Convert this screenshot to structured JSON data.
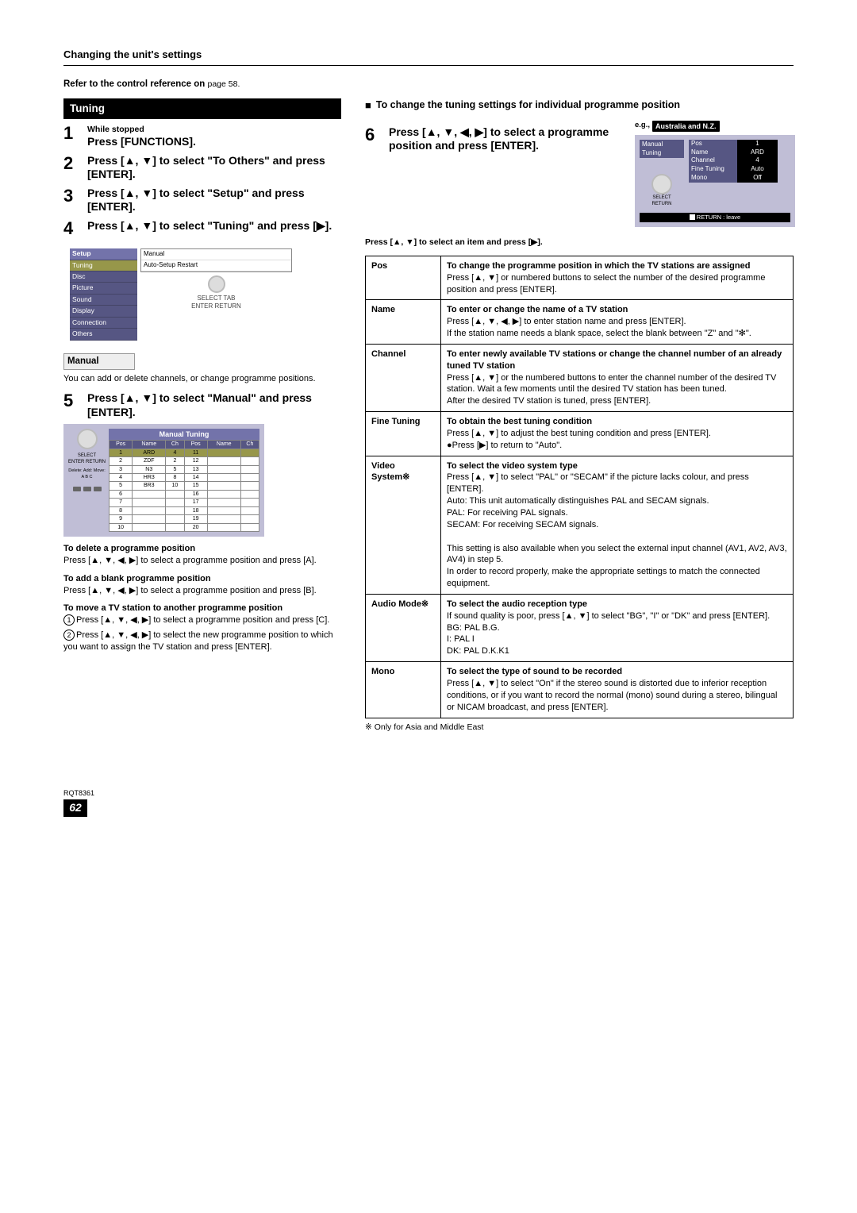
{
  "header": {
    "title": "Changing the unit's settings",
    "ref": "Refer to the control reference on ",
    "ref_page": "page 58."
  },
  "tuning_label": "Tuning",
  "steps": {
    "s1_small": "While stopped",
    "s1_main": "Press [FUNCTIONS].",
    "s2": "Press [▲, ▼] to select \"To Others\" and press [ENTER].",
    "s3": "Press [▲, ▼] to select \"Setup\" and press [ENTER].",
    "s4": "Press [▲, ▼] to select \"Tuning\" and press [▶].",
    "s5": "Press [▲, ▼] to select \"Manual\" and press [ENTER].",
    "s6": "Press [▲, ▼, ◀, ▶] to select a programme position and press [ENTER]."
  },
  "setup_box": {
    "menu": [
      "Setup",
      "Tuning",
      "Disc",
      "Picture",
      "Sound",
      "Display",
      "Connection",
      "Others"
    ],
    "panel": [
      "Manual",
      "Auto-Setup Restart"
    ],
    "icons": "SELECT    TAB\nENTER    RETURN"
  },
  "manual_head": "Manual",
  "manual_text": "You can add or delete channels, or change programme positions.",
  "mt": {
    "title": "Manual Tuning",
    "headers": [
      "Pos",
      "Name",
      "Ch",
      "Pos",
      "Name",
      "Ch"
    ],
    "rows": [
      [
        "1",
        "ARD",
        "4",
        "11",
        "",
        ""
      ],
      [
        "2",
        "ZDF",
        "2",
        "12",
        "",
        ""
      ],
      [
        "3",
        "N3",
        "5",
        "13",
        "",
        ""
      ],
      [
        "4",
        "HR3",
        "8",
        "14",
        "",
        ""
      ],
      [
        "5",
        "BR3",
        "10",
        "15",
        "",
        ""
      ],
      [
        "6",
        "",
        "",
        "16",
        "",
        ""
      ],
      [
        "7",
        "",
        "",
        "17",
        "",
        ""
      ],
      [
        "8",
        "",
        "",
        "18",
        "",
        ""
      ],
      [
        "9",
        "",
        "",
        "19",
        "",
        ""
      ],
      [
        "10",
        "",
        "",
        "20",
        "",
        ""
      ]
    ],
    "knob_labels": "SELECT\nENTER   RETURN",
    "bottom": "Delete:  Add:  Move:\n A       B     C"
  },
  "paras": {
    "del_h": "To delete a programme position",
    "del_b": "Press [▲, ▼, ◀, ▶] to select a programme position and press [A].",
    "add_h": "To add a blank programme position",
    "add_b": "Press [▲, ▼, ◀, ▶] to select a programme position and press [B].",
    "move_h": "To move a TV station to another programme position",
    "move_b1": "Press [▲, ▼, ◀, ▶] to select a programme position and press [C].",
    "move_b2": "Press [▲, ▼, ◀, ▶] to select the new programme position to which you want to assign the TV station and press [ENTER]."
  },
  "right_head": "To change the tuning settings for individual programme position",
  "eg": {
    "prefix": "e.g.,",
    "badge": "Australia and N.Z."
  },
  "mtune": {
    "left_label": "Manual Tuning",
    "fields": [
      [
        "Pos",
        "1"
      ],
      [
        "Name",
        "ARD"
      ],
      [
        "Channel",
        "4"
      ],
      [
        "Fine Tuning",
        "Auto"
      ],
      [
        "Mono",
        "Off"
      ]
    ],
    "knob": "SELECT\nRETURN",
    "bottom": "RETURN :  leave"
  },
  "select_note": "Press [▲, ▼] to select an item and press [▶].",
  "table": {
    "pos_h": "To change the programme position in which the TV stations are assigned",
    "pos_b": "Press [▲, ▼] or numbered buttons to select the number of the desired programme position and press [ENTER].",
    "name_h": "To enter or change the name of a TV station",
    "name_b": "Press [▲, ▼, ◀, ▶] to enter station name and press [ENTER].\nIf the station name needs a blank space, select the blank between \"Z\" and \"✻\".",
    "ch_h": "To enter newly available TV stations or change the channel number of an already tuned TV station",
    "ch_b": "Press [▲, ▼] or the numbered buttons to enter the channel number of the desired TV station. Wait a few moments until the desired TV station has been tuned.\nAfter the desired TV station is tuned, press [ENTER].",
    "ft_h": "To obtain the best tuning condition",
    "ft_b": "Press [▲, ▼] to adjust the best tuning condition and press [ENTER].\n●Press [▶] to return to \"Auto\".",
    "vs_h": "To select the video system type",
    "vs_b": "Press [▲, ▼] to select \"PAL\" or \"SECAM\" if the picture lacks colour, and press [ENTER].\nAuto:    This unit automatically distinguishes PAL and SECAM signals.\nPAL:     For receiving PAL signals.\nSECAM: For receiving SECAM signals.\n\nThis setting is also available when you select the external input channel (AV1, AV2, AV3, AV4) in step 5.\nIn order to record properly, make the appropriate settings to match the connected equipment.",
    "am_h": "To select the audio reception type",
    "am_b": "If sound quality is poor, press [▲, ▼] to select \"BG\", \"I\" or \"DK\" and press [ENTER].\nBG: PAL B.G.\nI:     PAL I\nDK: PAL D.K.K1",
    "mono_h": "To select the type of sound to be recorded",
    "mono_b": "Press [▲, ▼] to select \"On\" if the stereo sound is distorted due to inferior reception conditions, or if you want to record the normal (mono) sound during a stereo, bilingual or NICAM broadcast, and press [ENTER].",
    "keys": {
      "pos": "Pos",
      "name": "Name",
      "channel": "Channel",
      "ft": "Fine Tuning",
      "vs": "Video System※",
      "am": "Audio Mode※",
      "mono": "Mono"
    }
  },
  "footnote": "※ Only for Asia and Middle East",
  "footer": {
    "rqt": "RQT8361",
    "page": "62"
  }
}
